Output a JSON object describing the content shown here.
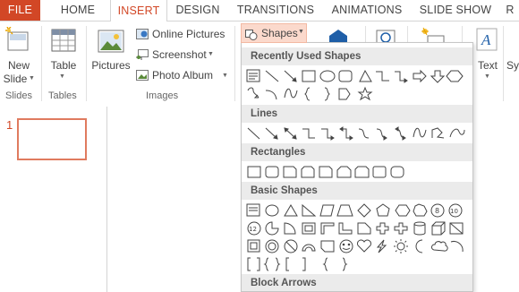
{
  "tabs": {
    "file": "FILE",
    "home": "HOME",
    "insert": "INSERT",
    "design": "DESIGN",
    "transitions": "TRANSITIONS",
    "animations": "ANIMATIONS",
    "slideshow": "SLIDE SHOW",
    "review_partial": "R"
  },
  "ribbon": {
    "new_slide_line1": "New",
    "new_slide_line2": "Slide",
    "table": "Table",
    "pictures": "Pictures",
    "online_pictures": "Online Pictures",
    "screenshot": "Screenshot",
    "photo_album": "Photo Album",
    "shapes": "Shapes",
    "text": "Text",
    "symbols_partial": "Sy",
    "groups": {
      "slides": "Slides",
      "tables": "Tables",
      "images": "Images"
    }
  },
  "thumbnails": {
    "slide_number": "1"
  },
  "shapes_menu": {
    "recent": "Recently Used Shapes",
    "lines": "Lines",
    "rectangles": "Rectangles",
    "basic": "Basic Shapes",
    "block_arrows": "Block Arrows"
  },
  "colors": {
    "accent": "#d24726",
    "selection_fill": "#fbd9cc",
    "thumb_border": "#e07b5f",
    "section_header": "#ebebeb"
  },
  "icons": [
    "new-slide-icon",
    "table-icon",
    "pictures-icon",
    "online-pictures-icon",
    "screenshot-icon",
    "photo-album-icon",
    "shapes-icon",
    "smartart-icon",
    "hyperlink-icon",
    "comment-icon",
    "text-icon"
  ]
}
